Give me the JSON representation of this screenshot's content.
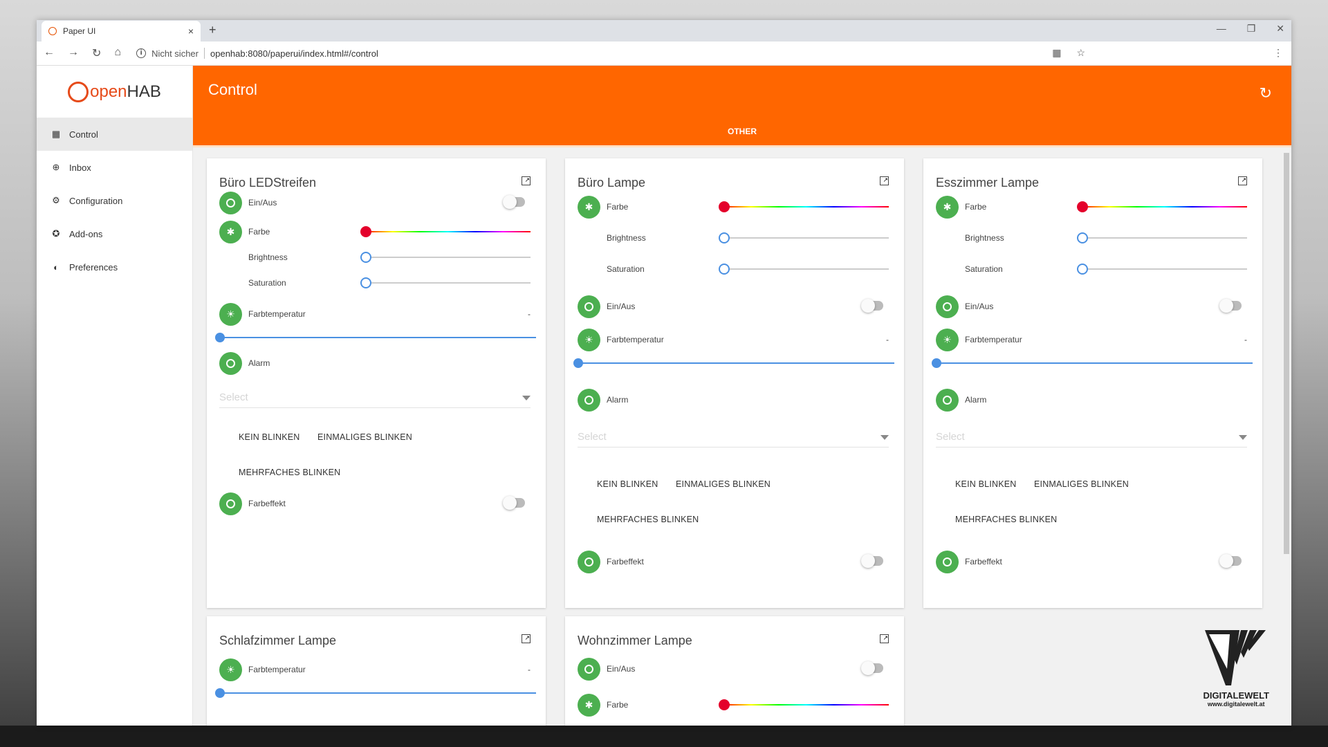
{
  "browser": {
    "tab_title": "Paper UI",
    "tab_close": "×",
    "new_tab": "+",
    "security_label": "Nicht sicher",
    "url": "openhab:8080/paperui/index.html#/control"
  },
  "app": {
    "logo_a": "open",
    "logo_b": "HAB",
    "page_title": "Control",
    "active_tab": "OTHER",
    "accent": "#ff6600",
    "toggle_on_color": "#4caf50"
  },
  "sidebar": {
    "items": [
      {
        "label": "Control",
        "icon": "dashboard-icon"
      },
      {
        "label": "Inbox",
        "icon": "inbox-icon"
      },
      {
        "label": "Configuration",
        "icon": "gear-icon"
      },
      {
        "label": "Add-ons",
        "icon": "puzzle-icon"
      },
      {
        "label": "Preferences",
        "icon": "preferences-icon"
      }
    ]
  },
  "labels": {
    "onoff": "Ein/Aus",
    "farbe": "Farbe",
    "brightness": "Brightness",
    "saturation": "Saturation",
    "farbtemp": "Farbtemperatur",
    "farbtemp_value": "-",
    "alarm": "Alarm",
    "select_placeholder": "Select",
    "btn_kein": "KEIN BLINKEN",
    "btn_einmal": "EINMALIGES BLINKEN",
    "btn_mehr": "MEHRFACHES BLINKEN",
    "farbeffekt": "Farbeffekt"
  },
  "cards": [
    {
      "title": "Büro LEDStreifen"
    },
    {
      "title": "Büro Lampe"
    },
    {
      "title": "Esszimmer Lampe"
    },
    {
      "title": "Schlafzimmer Lampe"
    },
    {
      "title": "Wohnzimmer Lampe"
    }
  ],
  "watermark": {
    "name": "DIGITALEWELT",
    "url": "www.digitalewelt.at"
  }
}
